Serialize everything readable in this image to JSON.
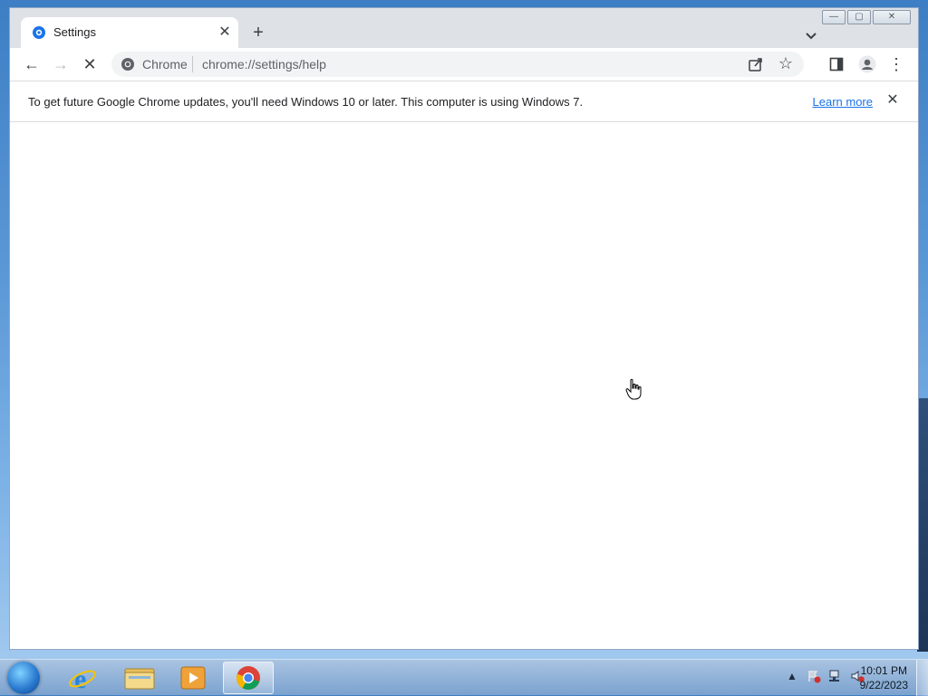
{
  "window": {
    "controls": {
      "minimize": "—",
      "maximize": "▢",
      "close": "✕"
    }
  },
  "tab": {
    "title": "Settings",
    "favicon": "settings-gear-icon",
    "close": "✕",
    "new_tab": "+"
  },
  "toolbar": {
    "back": "←",
    "forward": "→",
    "stop": "✕",
    "omnibox": {
      "scheme_label": "Chrome",
      "url": "chrome://settings/help",
      "star": "☆"
    },
    "side_panel_icon": "side-panel-icon",
    "profile_icon": "profile-icon",
    "menu": "⋮"
  },
  "infobar": {
    "message": "To get future Google Chrome updates, you'll need Windows 10 or later. This computer is using Windows 7.",
    "link": "Learn more",
    "close": "✕"
  },
  "taskbar": {
    "items": [
      "start-orb",
      "internet-explorer-icon",
      "file-explorer-icon",
      "media-player-icon",
      "chrome-icon"
    ],
    "tray": {
      "show_hidden": "▲"
    },
    "clock": {
      "time": "10:01 PM",
      "date": "9/22/2023"
    }
  }
}
